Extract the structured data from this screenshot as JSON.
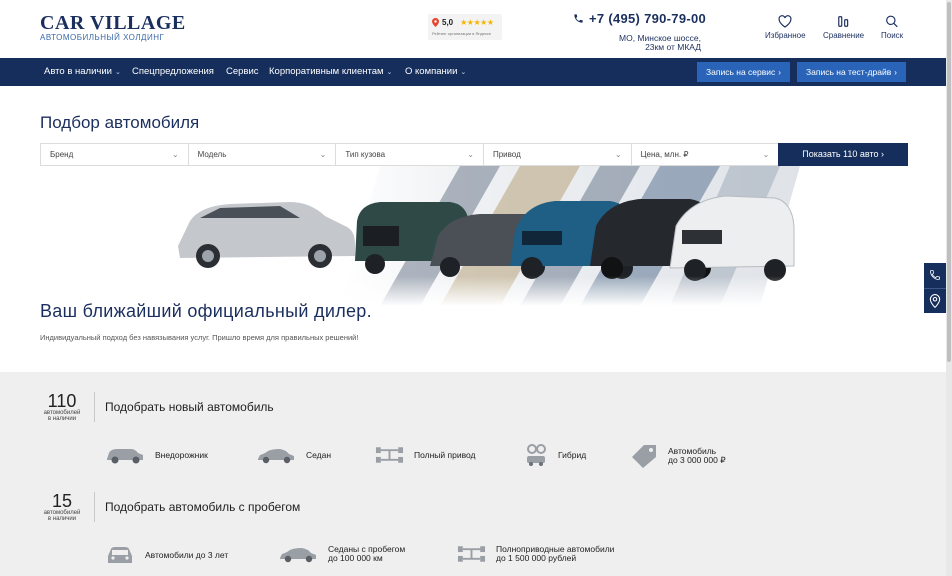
{
  "header": {
    "logo_main": "CAR VILLAGE",
    "logo_sub": "АВТОМОБИЛЬНЫЙ ХОЛДИНГ",
    "rating_value": "5,0",
    "rating_stars": "★★★★★",
    "rating_note": "Рейтинг организации в Яндексе",
    "phone": "+7 (495) 790-79-00",
    "address_line1": "МО, Минское шоссе,",
    "address_line2": "23км от МКАД",
    "favorites_label": "Избранное",
    "compare_label": "Сравнение",
    "search_label": "Поиск"
  },
  "nav": {
    "items": [
      "Авто в наличии",
      "Спецпредложения",
      "Сервис",
      "Корпоративным клиентам",
      "О компании"
    ],
    "service_button": "Запись на сервис",
    "testdrive_button": "Запись на тест-драйв"
  },
  "picker": {
    "title": "Подбор автомобиля",
    "filters": [
      "Бренд",
      "Модель",
      "Тип кузова",
      "Привод",
      "Цена, млн. ₽"
    ],
    "show_button": "Показать 110 авто"
  },
  "hero": {
    "title": "Ваш ближайший официальный дилер.",
    "subtitle": "Индивидуальный подход без навязывания услуг. Пришло время для правильных решений!"
  },
  "new_cars": {
    "count": "110",
    "count_label_line1": "автомобилей",
    "count_label_line2": "в наличии",
    "title": "Подобрать новый автомобиль",
    "categories": [
      {
        "label1": "Внедорожник",
        "label2": "",
        "icon": "suv-icon"
      },
      {
        "label1": "Седан",
        "label2": "",
        "icon": "sedan-icon"
      },
      {
        "label1": "Полный привод",
        "label2": "",
        "icon": "awd-icon"
      },
      {
        "label1": "Гибрид",
        "label2": "",
        "icon": "hybrid-icon"
      },
      {
        "label1": "Автомобиль",
        "label2": "до 3 000 000 ₽",
        "icon": "price-tag-icon"
      }
    ]
  },
  "used_cars": {
    "count": "15",
    "count_label_line1": "автомобилей",
    "count_label_line2": "в наличии",
    "title": "Подобрать автомобиль с пробегом",
    "categories": [
      {
        "label1": "Автомобили до 3 лет",
        "label2": "",
        "icon": "car-front-icon"
      },
      {
        "label1": "Седаны с пробегом",
        "label2": "до 100 000 км",
        "icon": "sedan-icon"
      },
      {
        "label1": "Полноприводные автомобили",
        "label2": "до 1 500 000 рублей",
        "icon": "awd-icon"
      }
    ]
  },
  "colors": {
    "brand_dark": "#152e5c",
    "brand_button": "#2a64b8",
    "section_bg": "#efefef"
  }
}
